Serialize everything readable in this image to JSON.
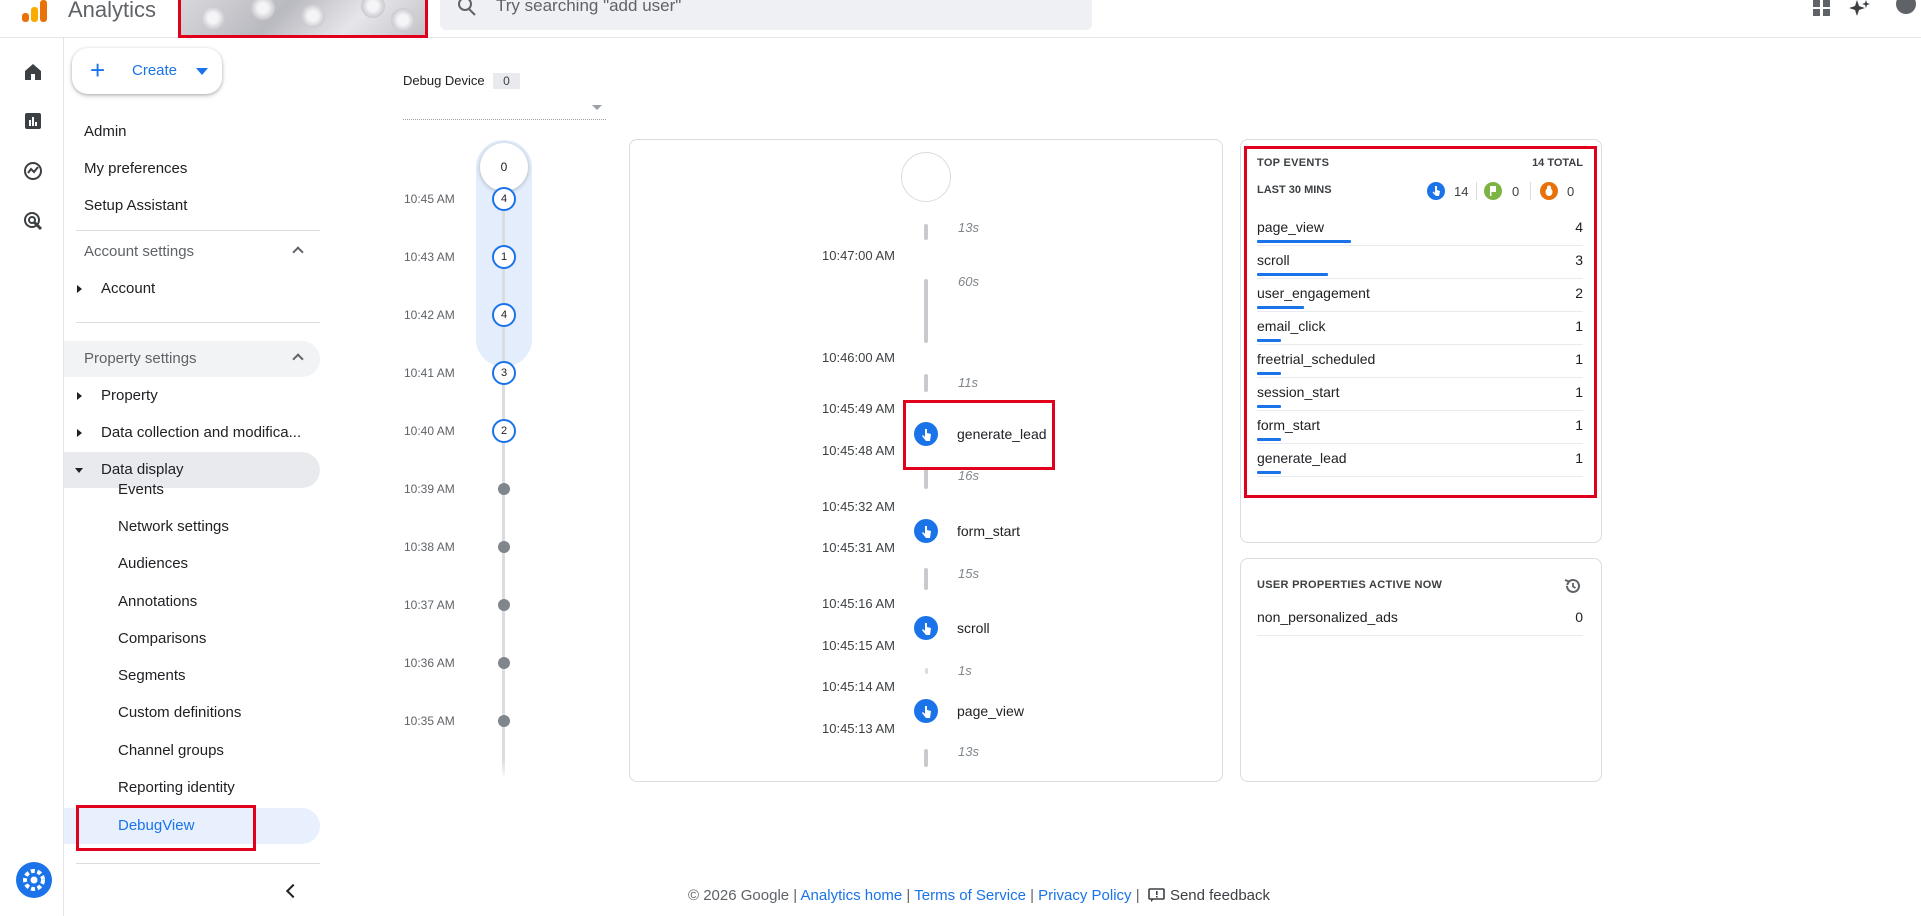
{
  "app": {
    "title": "Analytics"
  },
  "search": {
    "placeholder": "Try searching \"add user\""
  },
  "nav": {
    "create_label": "Create",
    "admin": "Admin",
    "preferences": "My preferences",
    "setup": "Setup Assistant",
    "account_settings": "Account settings",
    "account": "Account",
    "property_settings": "Property settings",
    "property": "Property",
    "data_collection": "Data collection and modifica...",
    "data_display": "Data display",
    "sub_items": [
      "Events",
      "Network settings",
      "Audiences",
      "Annotations",
      "Comparisons",
      "Segments",
      "Custom definitions",
      "Channel groups",
      "Reporting identity"
    ],
    "debugview": "DebugView"
  },
  "device": {
    "label": "Debug Device",
    "count": "0"
  },
  "minutes": {
    "top_count": "0",
    "rows": [
      {
        "time": "10:45 AM",
        "count": "4"
      },
      {
        "time": "10:43 AM",
        "count": "1"
      },
      {
        "time": "10:42 AM",
        "count": "4"
      },
      {
        "time": "10:41 AM",
        "count": "3"
      },
      {
        "time": "10:40 AM",
        "count": "2"
      },
      {
        "time": "10:39 AM",
        "count": ""
      },
      {
        "time": "10:38 AM",
        "count": ""
      },
      {
        "time": "10:37 AM",
        "count": ""
      },
      {
        "time": "10:36 AM",
        "count": ""
      },
      {
        "time": "10:35 AM",
        "count": ""
      }
    ]
  },
  "seconds": {
    "times": [
      "10:47:00 AM",
      "10:46:00 AM",
      "10:45:49 AM",
      "10:45:48 AM",
      "10:45:32 AM",
      "10:45:31 AM",
      "10:45:16 AM",
      "10:45:15 AM",
      "10:45:14 AM",
      "10:45:13 AM"
    ],
    "durations": [
      "13s",
      "60s",
      "11s",
      "16s",
      "15s",
      "1s",
      "13s"
    ],
    "events": [
      "generate_lead",
      "form_start",
      "scroll",
      "page_view"
    ]
  },
  "top_events": {
    "title": "TOP EVENTS",
    "total": "14 TOTAL",
    "subtitle": "LAST 30 MINS",
    "stats": [
      {
        "icon": "hand-pointer-icon",
        "color": "#1a73e8",
        "value": "14"
      },
      {
        "icon": "flag-icon",
        "color": "#7cb342",
        "value": "0"
      },
      {
        "icon": "bug-icon",
        "color": "#e8710a",
        "value": "0"
      }
    ],
    "rows": [
      {
        "name": "page_view",
        "count": "4",
        "share": 1.0
      },
      {
        "name": "scroll",
        "count": "3",
        "share": 0.75
      },
      {
        "name": "user_engagement",
        "count": "2",
        "share": 0.5
      },
      {
        "name": "email_click",
        "count": "1",
        "share": 0.25
      },
      {
        "name": "freetrial_scheduled",
        "count": "1",
        "share": 0.25
      },
      {
        "name": "session_start",
        "count": "1",
        "share": 0.25
      },
      {
        "name": "form_start",
        "count": "1",
        "share": 0.25
      },
      {
        "name": "generate_lead",
        "count": "1",
        "share": 0.25
      }
    ]
  },
  "user_properties": {
    "title": "USER PROPERTIES ACTIVE NOW",
    "rows": [
      {
        "name": "non_personalized_ads",
        "value": "0"
      }
    ]
  },
  "footer": {
    "copyright": "© 2026 Google",
    "analytics_home": "Analytics home",
    "terms": "Terms of Service",
    "privacy": "Privacy Policy",
    "feedback": "Send feedback"
  },
  "colors": {
    "accent": "#1a73e8",
    "highlight": "#e0001b"
  }
}
